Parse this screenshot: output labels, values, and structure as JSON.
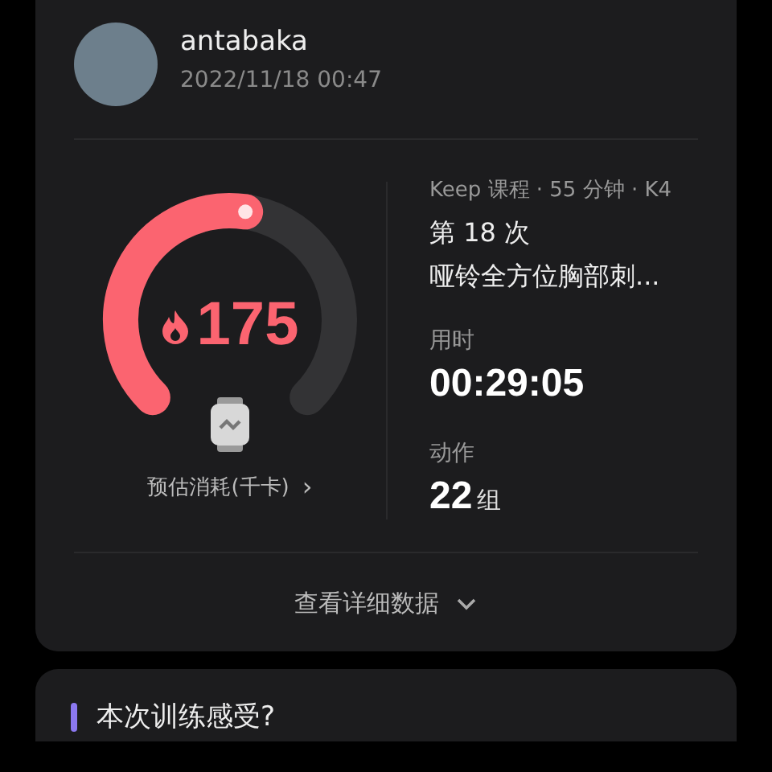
{
  "user": {
    "name": "antabaka",
    "time": "2022/11/18 00:47"
  },
  "calories": {
    "value": "175",
    "level": 0.53,
    "label": "预估消耗(千卡)",
    "chevron": "›"
  },
  "course": {
    "meta": "Keep 课程 · 55 分钟 · K4",
    "count": "第 18 次",
    "title": "哑铃全方位胸部刺..."
  },
  "stats": [
    {
      "label": "用时",
      "value": "00:29:05"
    },
    {
      "label": "动作",
      "value": "22",
      "unit": "组"
    }
  ],
  "details_link": "查看详细数据",
  "feedback_title": "本次训练感受?"
}
